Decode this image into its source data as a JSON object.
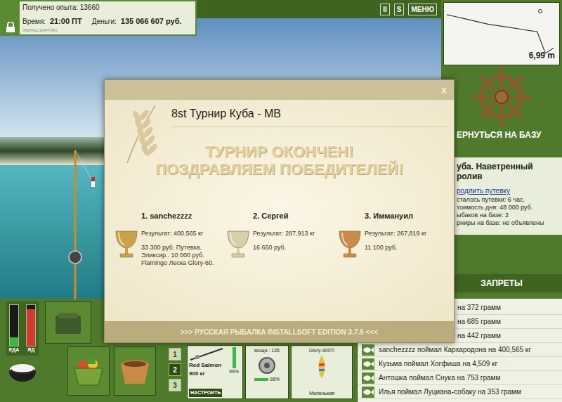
{
  "hud": {
    "experience": "Получено опыта: 13660",
    "time_label": "Время:",
    "time": "21:00 ПТ",
    "money_label": "Деньги:",
    "money": "135 066 607 руб.",
    "watermark": "INSTALLSOFT.RU"
  },
  "top_buttons": [
    {
      "label": "II"
    },
    {
      "label": "S"
    },
    {
      "label": "МЕНЮ"
    }
  ],
  "depth": {
    "reading": "6,99 m",
    "profile": [
      1.2,
      1.5,
      1.8,
      2.1,
      2.4,
      2.7,
      2.9,
      3.1,
      3.3,
      3.5,
      3.7,
      3.9,
      7.3,
      6.5
    ]
  },
  "base": {
    "button": "ЕРНУТЬСЯ НА БАЗУ",
    "location": [
      "уба. Наветренный",
      "ролив"
    ],
    "extend_link": "родлить путевку",
    "info": [
      "сталось путевки: 6 час.",
      "тоимость дня: 48 000 руб.",
      "ыбаков на базе: 2",
      "рниры на базе: не объявлены"
    ]
  },
  "bans_header": "ЗАПРЕТЫ",
  "catch_log": [
    {
      "text": "на 372 грамм",
      "kind": "covered"
    },
    {
      "text": "на 685 грамм",
      "kind": "covered"
    },
    {
      "text": "на 442 грамм",
      "kind": "covered"
    },
    {
      "text": "sanchezzzz поймал Кархародона на 400,565 кг",
      "kind": "entry"
    },
    {
      "text": "Кузьма поймал Хогфиша на 4,509 кг",
      "kind": "entry"
    },
    {
      "text": "Антошка поймал Снука на 753 грамм",
      "kind": "entry"
    },
    {
      "text": "Илья поймал Луциана-собаку на 353 грамм",
      "kind": "entry"
    }
  ],
  "meters": [
    {
      "label": "ЕДА",
      "level": 0.2,
      "color": "#3cb54a"
    },
    {
      "label": "ЯД",
      "level": 0.9,
      "color": "#d23a32"
    }
  ],
  "slots": [
    {
      "label": "1",
      "selected": false
    },
    {
      "label": "2",
      "selected": true
    },
    {
      "label": "3",
      "selected": false
    }
  ],
  "tackle": {
    "rod": {
      "name": "Red Salmon",
      "load": "900 кг",
      "condition": "99%",
      "level": 0.99,
      "button": "НАСТРОИТЬ"
    },
    "reel": {
      "power": "мощн.: 135",
      "condition": "98%",
      "level": 0.98
    },
    "line": {
      "name": "Glory-900Ti"
    },
    "lure": {
      "name": "Маленькая"
    }
  },
  "dialog": {
    "title": "8st Турнир Куба - МВ",
    "close": "x",
    "headline": [
      "ТУРНИР ОКОНЧЕН!",
      "ПОЗДРАВЛЯЕМ ПОБЕДИТЕЛЕЙ!"
    ],
    "winners": [
      {
        "place": "1. sanchezzzz",
        "result": "Результат: 400,565 кг",
        "prizes": [
          "33 300 руб. Путевка.",
          "Эликсир.. 10 000 руб.",
          "Flamingo Леска Glory-60."
        ],
        "color": "#c9a24a"
      },
      {
        "place": "2. Сергей",
        "result": "Результат: 287,913 кг",
        "prizes": [
          "16 650 руб."
        ],
        "color": "#d8cfa8"
      },
      {
        "place": "3. Иммануил",
        "result": "Результат: 267,819 кг",
        "prizes": [
          "11 100 руб."
        ],
        "color": "#c98a4a"
      }
    ],
    "footer": ">>> РУССКАЯ РЫБАЛКА INSTALLSOFT EDITION 3.7.5 <<<"
  }
}
